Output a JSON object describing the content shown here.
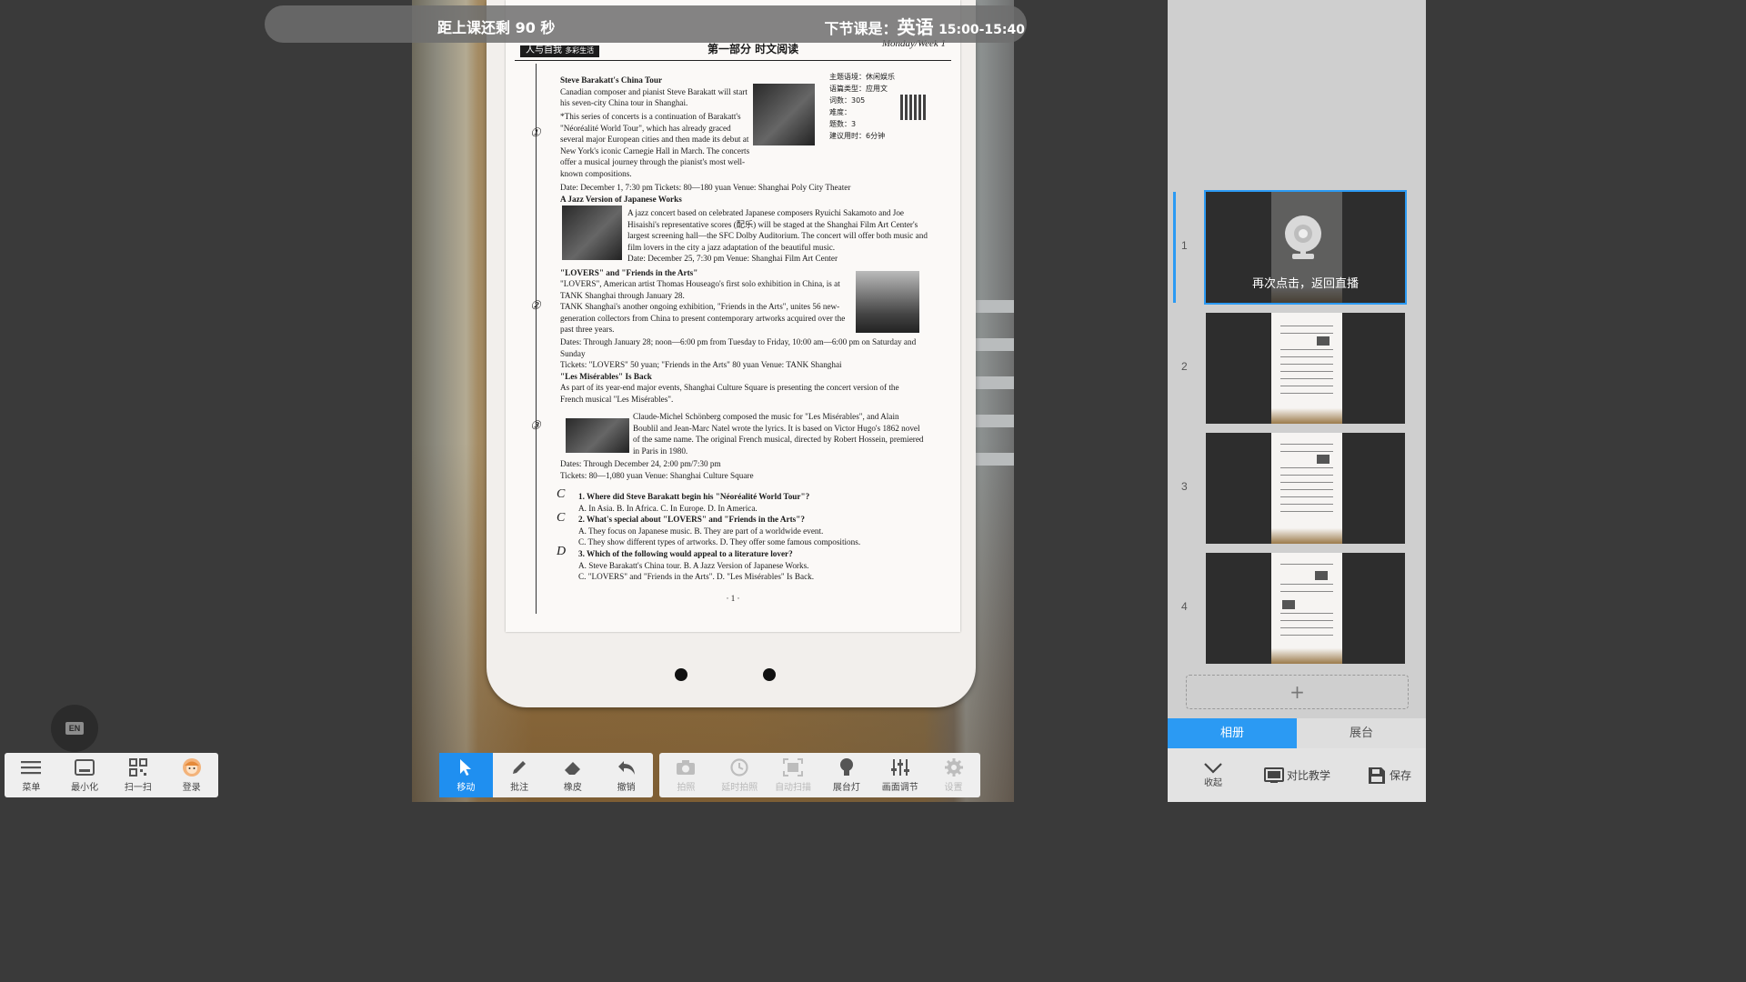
{
  "status_bar": {
    "countdown": "距上课还剩 90 秒",
    "next_prefix": "下节课是：",
    "next_subject": "英语",
    "next_time": "15:00-15:40"
  },
  "document": {
    "tag": "人与自我",
    "tag_sub": "多彩生活",
    "part": "第一部分  时文阅读",
    "week": "Monday/Week 1",
    "meta": [
      "主题语境：休闲娱乐",
      "语篇类型：应用文",
      "词数：305",
      "难度：",
      "题数：3",
      "建议用时：6分钟"
    ],
    "title1": "Steve Barakatt's China Tour",
    "p1": "Canadian composer and pianist Steve Barakatt will start his seven-city China tour in Shanghai.",
    "p2": "*This series of concerts is a continuation of Barakatt's \"Néoréalité World Tour\", which has already graced several major European cities and then made its debut at New York's iconic Carnegie Hall in March. The concerts offer a musical journey through the pianist's most well-known compositions.",
    "p3": "Date: December 1, 7:30 pm    Tickets: 80—180 yuan    Venue: Shanghai Poly City Theater",
    "title2": "A Jazz Version of Japanese Works",
    "p4": "A jazz concert based on celebrated Japanese composers Ryuichi Sakamoto and Joe Hisaishi's representative scores (配乐) will be staged at the Shanghai Film Art Center's largest screening hall—the SFC Dolby Auditorium. The concert will offer both music and film lovers in the city a jazz adaptation of the beautiful music.",
    "p5": "Date: December 25, 7:30 pm    Venue: Shanghai Film Art Center",
    "title3": "\"LOVERS\" and \"Friends in the Arts\"",
    "p6": "\"LOVERS\", American artist Thomas Houseago's first solo exhibition in China, is at TANK Shanghai through January 28.",
    "p7": "TANK Shanghai's another ongoing exhibition, \"Friends in the Arts\", unites 56 new-generation collectors from China to present contemporary artworks acquired over the past three years.",
    "p8": "Dates: Through January 28; noon—6:00 pm from Tuesday to Friday, 10:00 am—6:00 pm on Saturday and Sunday",
    "p9": "Tickets: \"LOVERS\" 50 yuan; \"Friends in the Arts\" 80 yuan    Venue: TANK Shanghai",
    "title4": "\"Les Misérables\" Is Back",
    "p10": "As part of its year-end major events, Shanghai Culture Square is presenting the concert version of the French musical \"Les Misérables\".",
    "p11": "Claude-Michel Schönberg composed the music for \"Les Misérables\", and Alain Boublil and Jean-Marc Natel wrote the lyrics. It is based on Victor Hugo's 1862 novel of the same name. The original French musical, directed by Robert Hossein, premiered in Paris in 1980.",
    "p12": "Dates: Through December 24, 2:00 pm/7:30 pm",
    "p13": "Tickets: 80—1,080 yuan    Venue: Shanghai Culture Square",
    "q1": "1. Where did Steve Barakatt begin his \"Néoréalité World Tour\"?",
    "q1o": "A. In Asia.    B. In Africa.    C. In Europe.    D. In America.",
    "q2": "2. What's special about \"LOVERS\" and \"Friends in the Arts\"?",
    "q2o1": "A. They focus on Japanese music.    B. They are part of a worldwide event.",
    "q2o2": "C. They show different types of artworks.    D. They offer some famous compositions.",
    "q3": "3. Which of the following would appeal to a literature lover?",
    "q3o1": "A. Steve Barakatt's China tour.    B. A Jazz Version of Japanese Works.",
    "q3o2": "C. \"LOVERS\" and \"Friends in the Arts\".    D. \"Les Misérables\" Is Back.",
    "page_no": "· 1 ·",
    "marks": [
      "①",
      "②",
      "③"
    ],
    "answers": [
      "C",
      "C",
      "D"
    ]
  },
  "lang_button": {
    "label": "EN"
  },
  "left_toolbar": [
    {
      "label": "菜单",
      "icon": "menu-icon"
    },
    {
      "label": "最小化",
      "icon": "minimize-icon"
    },
    {
      "label": "扫一扫",
      "icon": "qrcode-icon"
    },
    {
      "label": "登录",
      "icon": "avatar-icon"
    }
  ],
  "edit_toolbar": [
    {
      "label": "移动",
      "icon": "cursor-icon",
      "active": true
    },
    {
      "label": "批注",
      "icon": "pen-icon"
    },
    {
      "label": "橡皮",
      "icon": "eraser-icon"
    },
    {
      "label": "撤销",
      "icon": "undo-icon"
    }
  ],
  "func_toolbar": [
    {
      "label": "拍照",
      "icon": "camera-icon",
      "disabled": true
    },
    {
      "label": "延时拍照",
      "icon": "timer-icon",
      "disabled": true
    },
    {
      "label": "自动扫描",
      "icon": "scan-icon",
      "disabled": true
    },
    {
      "label": "展台灯",
      "icon": "lamp-icon"
    },
    {
      "label": "画面调节",
      "icon": "sliders-icon"
    },
    {
      "label": "设置",
      "icon": "gear-icon",
      "disabled": true
    }
  ],
  "side_panel": {
    "pages": [
      "1",
      "2",
      "3",
      "4"
    ],
    "live_label": "再次点击，返回直播",
    "add_label": "+",
    "tabs": {
      "album": "相册",
      "showcase": "展台"
    },
    "actions": {
      "collapse": "收起",
      "compare": "对比教学",
      "save": "保存"
    }
  },
  "colors": {
    "accent": "#2b9af3",
    "active_tool": "#1f8ff0"
  }
}
